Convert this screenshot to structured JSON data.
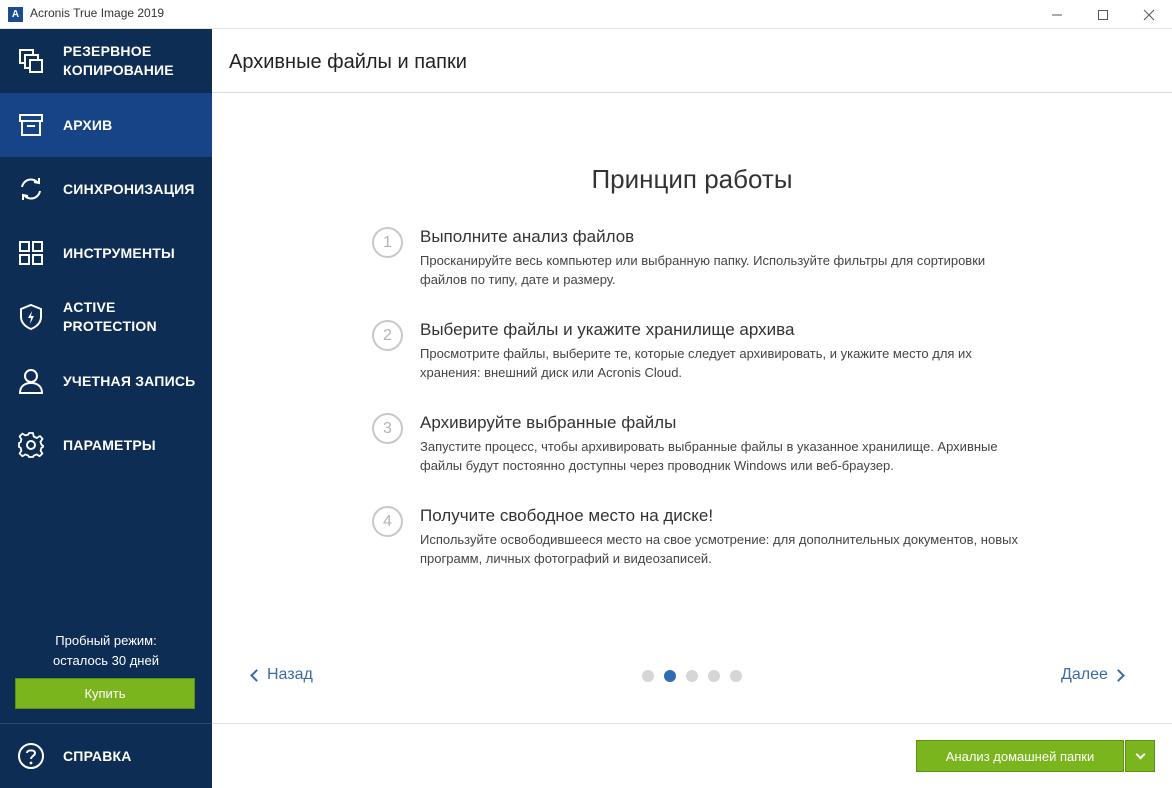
{
  "window": {
    "title": "Acronis True Image 2019",
    "logo_letter": "A"
  },
  "sidebar": {
    "items": [
      {
        "label": "РЕЗЕРВНОЕ\nКОПИРОВАНИЕ",
        "icon": "backup-icon"
      },
      {
        "label": "АРХИВ",
        "icon": "archive-icon"
      },
      {
        "label": "СИНХРОНИЗАЦИЯ",
        "icon": "sync-icon"
      },
      {
        "label": "ИНСТРУМЕНТЫ",
        "icon": "tools-icon"
      },
      {
        "label": "ACTIVE\nPROTECTION",
        "icon": "shield-icon"
      },
      {
        "label": "УЧЕТНАЯ ЗАПИСЬ",
        "icon": "account-icon"
      },
      {
        "label": "ПАРАМЕТРЫ",
        "icon": "gear-icon"
      }
    ],
    "active_index": 1,
    "trial_line1": "Пробный режим:",
    "trial_line2": "осталось 30 дней",
    "buy_label": "Купить",
    "help_label": "СПРАВКА"
  },
  "header": {
    "title": "Архивные файлы и папки"
  },
  "main": {
    "heading": "Принцип работы",
    "steps": [
      {
        "num": "1",
        "title": "Выполните анализ файлов",
        "desc": "Просканируйте весь компьютер или выбранную папку. Используйте фильтры для сортировки файлов по типу, дате и размеру."
      },
      {
        "num": "2",
        "title": "Выберите файлы и укажите хранилище архива",
        "desc": "Просмотрите файлы, выберите те, которые следует архивировать, и укажите место для их хранения: внешний диск или Acronis Cloud."
      },
      {
        "num": "3",
        "title": "Архивируйте выбранные файлы",
        "desc": "Запустите процесс, чтобы архивировать выбранные файлы в указанное хранилище. Архивные файлы будут постоянно доступны через проводник Windows или веб-браузер."
      },
      {
        "num": "4",
        "title": "Получите свободное место на диске!",
        "desc": "Используйте освободившееся место на свое усмотрение: для дополнительных документов, новых программ, личных фотографий и видеозаписей."
      }
    ],
    "back_label": "Назад",
    "next_label": "Далее",
    "pager": {
      "total": 5,
      "current": 2
    }
  },
  "footer": {
    "primary_label": "Анализ домашней папки"
  },
  "colors": {
    "sidebar_bg": "#0d2d54",
    "sidebar_active": "#174487",
    "accent_green": "#7ab51d",
    "link_blue": "#3a6ba8"
  }
}
